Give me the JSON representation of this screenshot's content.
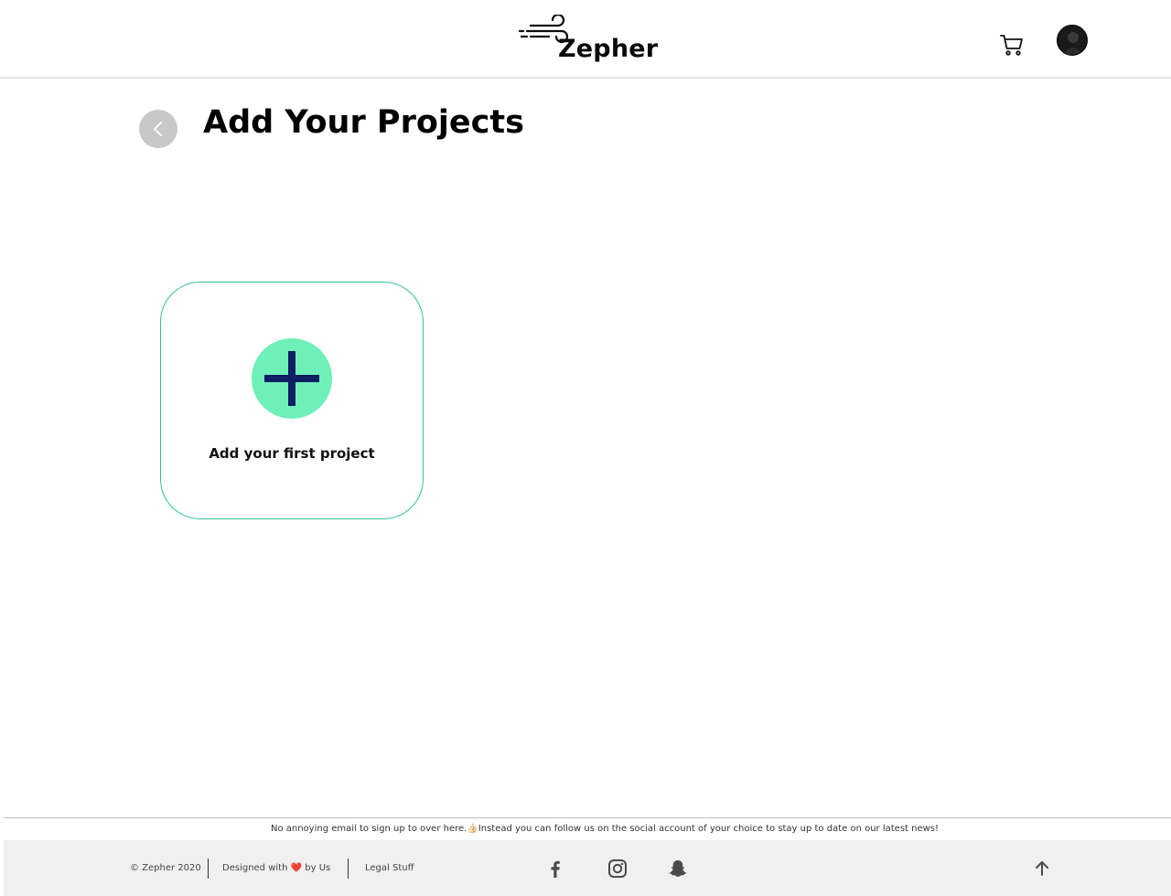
{
  "header": {
    "logo_text": "Zepher",
    "cart_icon": "cart-icon",
    "avatar_icon": "avatar-icon"
  },
  "main": {
    "title": "Add Your Projects",
    "back_icon": "chevron-left-icon",
    "add_card": {
      "label": "Add your first project",
      "icon": "plus-icon"
    }
  },
  "footer": {
    "note": "No annoying email to sign up to over here.👍🏻Instead you can follow us on the social account of your choice to stay up to date on our latest news!",
    "copyright": "© Zepher 2020",
    "designed_prefix": "Designed with",
    "designed_heart": "❤️",
    "designed_suffix": "by Us",
    "legal": "Legal Stuff",
    "social": [
      "facebook-icon",
      "instagram-icon",
      "snapchat-icon"
    ],
    "to_top_icon": "arrow-up-icon"
  },
  "colors": {
    "accent_border": "#2fc58b",
    "plus_bg": "#6ff0b8",
    "plus_fg": "#0f1f63",
    "back_btn": "#c8c8c8",
    "footer_bg": "#f0f0f0"
  }
}
